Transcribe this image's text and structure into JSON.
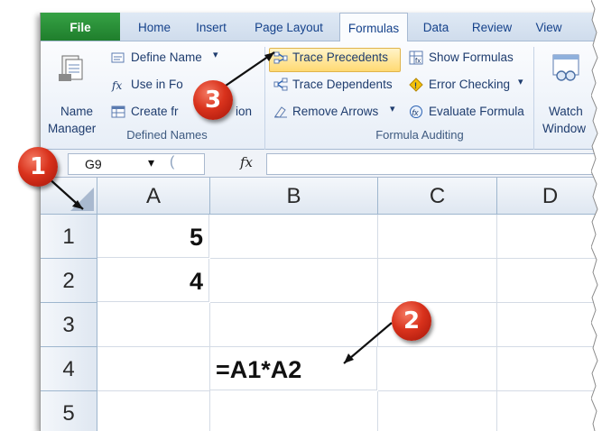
{
  "tabs": {
    "file": "File",
    "home": "Home",
    "insert": "Insert",
    "page_layout": "Page Layout",
    "formulas": "Formulas",
    "data": "Data",
    "review": "Review",
    "view": "View"
  },
  "ribbon": {
    "defined_names": {
      "name_manager_line1": "Name",
      "name_manager_line2": "Manager",
      "define_name": "Define Name",
      "use_in_formula": "Use in Fo",
      "create_from_selection": "Create fr",
      "create_tail": "ion",
      "group_label": "Defined Names"
    },
    "formula_auditing": {
      "trace_precedents": "Trace Precedents",
      "trace_dependents": "Trace Dependents",
      "remove_arrows": "Remove Arrows",
      "show_formulas": "Show Formulas",
      "error_checking": "Error Checking",
      "evaluate_formula": "Evaluate Formula",
      "group_label": "Formula Auditing"
    },
    "watch": {
      "line1": "Watch",
      "line2": "Window"
    }
  },
  "formula_bar": {
    "name_box": "G9",
    "fx": "fx",
    "formula": ""
  },
  "sheet": {
    "columns": [
      "A",
      "B",
      "C",
      "D"
    ],
    "rows": [
      "1",
      "2",
      "3",
      "4",
      "5"
    ],
    "cells": {
      "A1": "5",
      "A2": "4",
      "B4": "=A1*A2"
    }
  },
  "callouts": [
    "1",
    "2",
    "3"
  ],
  "colors": {
    "file_tab": "#1f7e2c",
    "callout": "#d9321c",
    "highlight": "#ffd972"
  }
}
